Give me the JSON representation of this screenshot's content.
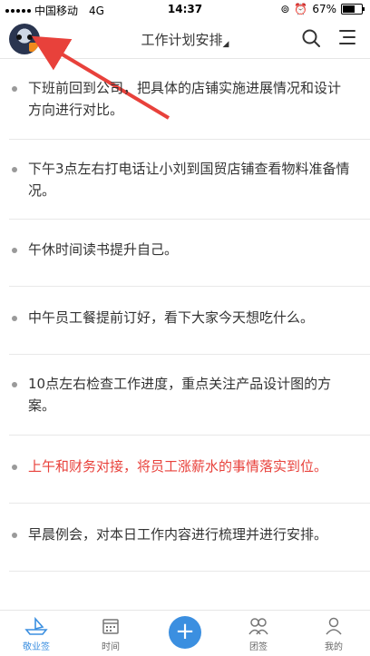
{
  "status_bar": {
    "carrier": "中国移动",
    "network": "4G",
    "time": "14:37",
    "battery": "67%",
    "battery_level": 0.67
  },
  "nav": {
    "title": "工作计划安排"
  },
  "tasks": [
    {
      "text": "下班前回到公司，把具体的店铺实施进展情况和设计方向进行对比。"
    },
    {
      "text": "下午3点左右打电话让小刘到国贸店铺查看物料准备情况。"
    },
    {
      "text": "午休时间读书提升自己。"
    },
    {
      "text": "中午员工餐提前订好，看下大家今天想吃什么。"
    },
    {
      "text": "10点左右检查工作进度，重点关注产品设计图的方案。"
    },
    {
      "text": "上午和财务对接，将员工涨薪水的事情落实到位。"
    },
    {
      "text": "早晨例会，对本日工作内容进行梳理并进行安排。"
    }
  ],
  "tabbar": {
    "tab1": "敬业签",
    "tab2": "时间",
    "fab": "+",
    "tab4": "团签",
    "tab5": "我的"
  },
  "colors": {
    "accent": "#3b8fe0",
    "highlight_task": "#e8413b",
    "annotation_arrow": "#e8413b"
  }
}
